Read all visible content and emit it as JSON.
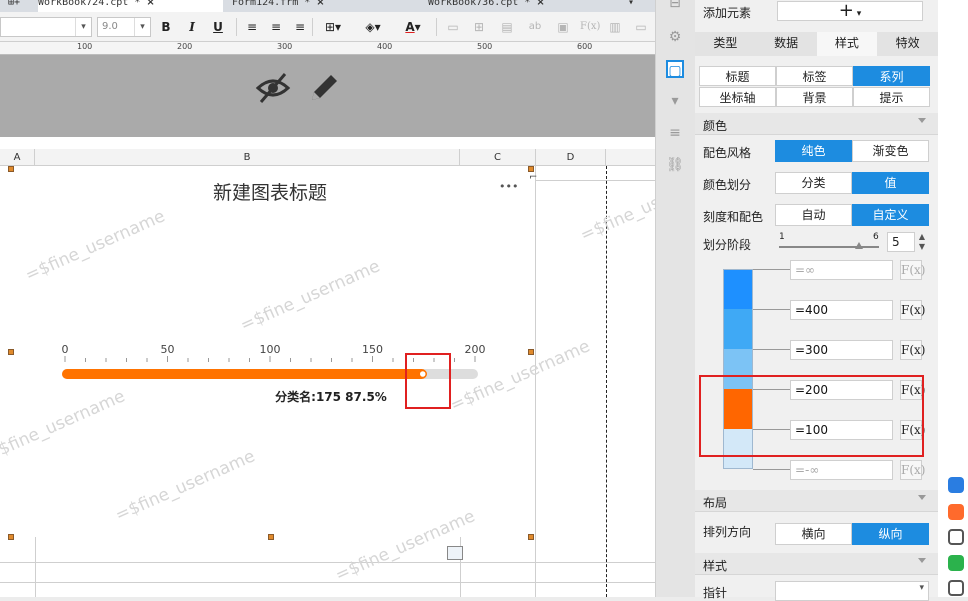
{
  "tabs": [
    {
      "label": "WorkBook724.cpt *",
      "active": true
    },
    {
      "label": "Form124.frm *",
      "active": false
    },
    {
      "label": "WorkBook736.cpt *",
      "active": false
    }
  ],
  "toolbar": {
    "font_size": "9.0",
    "bold": "B",
    "italic": "I",
    "underline": "U",
    "font_color": "A",
    "formula": "F(x)",
    "text": "ab"
  },
  "ruler": [
    "100",
    "200",
    "300",
    "400",
    "500",
    "600"
  ],
  "columns": [
    "A",
    "B",
    "C",
    "D"
  ],
  "chart": {
    "title": "新建图表标题",
    "more": "•••",
    "ticks": [
      "0",
      "50",
      "100",
      "150",
      "200"
    ],
    "label": "分类名:175 87.5%",
    "bar_color": "#ff7300",
    "track_color": "#dddddd"
  },
  "chart_data": {
    "type": "bar",
    "categories": [
      "分类名"
    ],
    "values": [
      175
    ],
    "percent": "87.5%",
    "title": "新建图表标题",
    "xlim": [
      0,
      200
    ]
  },
  "watermark": "=$fine_username",
  "panel": {
    "add_element_label": "添加元素",
    "add_icon": "+",
    "main_tabs": [
      "类型",
      "数据",
      "样式",
      "特效"
    ],
    "main_tab_selected": 2,
    "sub_tabs": [
      "标题",
      "标签",
      "系列",
      "坐标轴",
      "背景",
      "提示"
    ],
    "sub_tab_selected": 2,
    "color_section": "颜色",
    "color_style_label": "配色风格",
    "color_style_opts": [
      "纯色",
      "渐变色"
    ],
    "color_style_selected": 0,
    "color_division_label": "颜色划分",
    "color_division_opts": [
      "分类",
      "值"
    ],
    "color_division_selected": 1,
    "scale_color_label": "刻度和配色",
    "scale_color_opts": [
      "自动",
      "自定义"
    ],
    "scale_color_selected": 1,
    "stages_label": "划分阶段",
    "slider_min": "1",
    "slider_max": "6",
    "stages_value": "5",
    "stages": [
      {
        "value": "=∞",
        "color": "#1e90ff",
        "dim": true
      },
      {
        "value": "=400",
        "color": "#3fa9f5",
        "dim": false
      },
      {
        "value": "=300",
        "color": "#7cc3f5",
        "dim": false
      },
      {
        "value": "=200",
        "color": "#ff6600",
        "dim": false
      },
      {
        "value": "=100",
        "color": "#d3e8f8",
        "dim": false
      },
      {
        "value": "=-∞",
        "color": "#d3e8f8",
        "dim": true
      }
    ],
    "fx_label": "F(x)",
    "layout_section": "布局",
    "direction_label": "排列方向",
    "direction_opts": [
      "横向",
      "纵向"
    ],
    "direction_selected": 1,
    "style_section": "样式",
    "pointer_label": "指针"
  }
}
